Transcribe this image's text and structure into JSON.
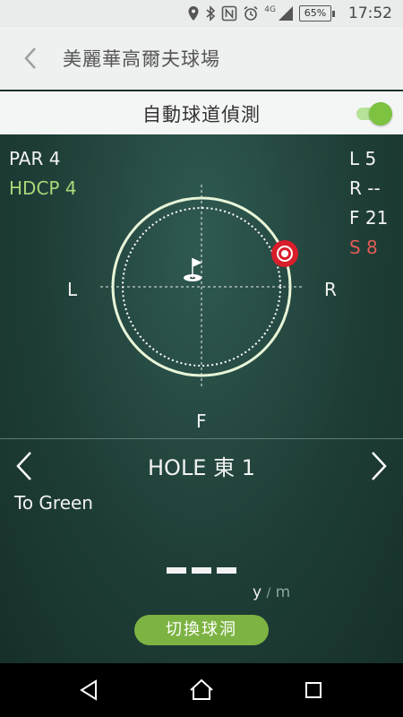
{
  "status": {
    "network": "4G",
    "battery": "65%",
    "time": "17:52"
  },
  "header": {
    "title": "美麗華高爾夫球場"
  },
  "auto_detect": {
    "label": "自動球道偵測",
    "enabled": true
  },
  "hole_info": {
    "par": "PAR 4",
    "hdcp": "HDCP 4",
    "stats": {
      "l": "L 5",
      "r": "R --",
      "f": "F 21",
      "s": "S 8"
    }
  },
  "radar": {
    "left_label": "L",
    "right_label": "R",
    "bottom_label": "F"
  },
  "hole_nav": {
    "title": "HOLE 東 1"
  },
  "distance": {
    "label": "To Green",
    "unit_yard": "y",
    "unit_sep": "/",
    "unit_meter": "m"
  },
  "switch_button": {
    "label": "切換球洞"
  },
  "colors": {
    "accent_green": "#7cb342",
    "hdcp_green": "#a8d878",
    "stat_red": "#e25c55",
    "marker_red": "#d81e2a"
  }
}
